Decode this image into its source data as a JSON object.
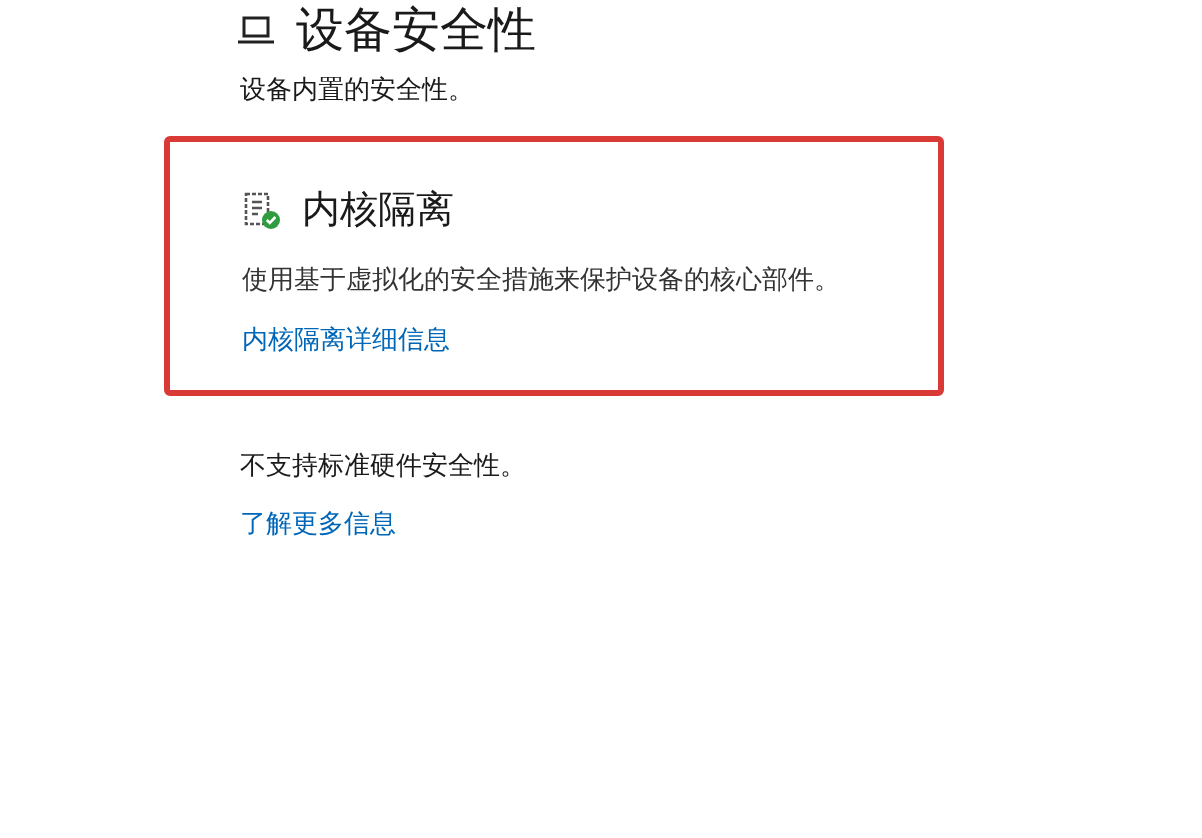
{
  "page": {
    "title": "设备安全性",
    "subtitle": "设备内置的安全性。"
  },
  "sections": [
    {
      "title": "内核隔离",
      "description": "使用基于虚拟化的安全措施来保护设备的核心部件。",
      "link": "内核隔离详细信息",
      "highlighted": true
    }
  ],
  "hardware": {
    "status": "不支持标准硬件安全性。",
    "link": "了解更多信息"
  }
}
